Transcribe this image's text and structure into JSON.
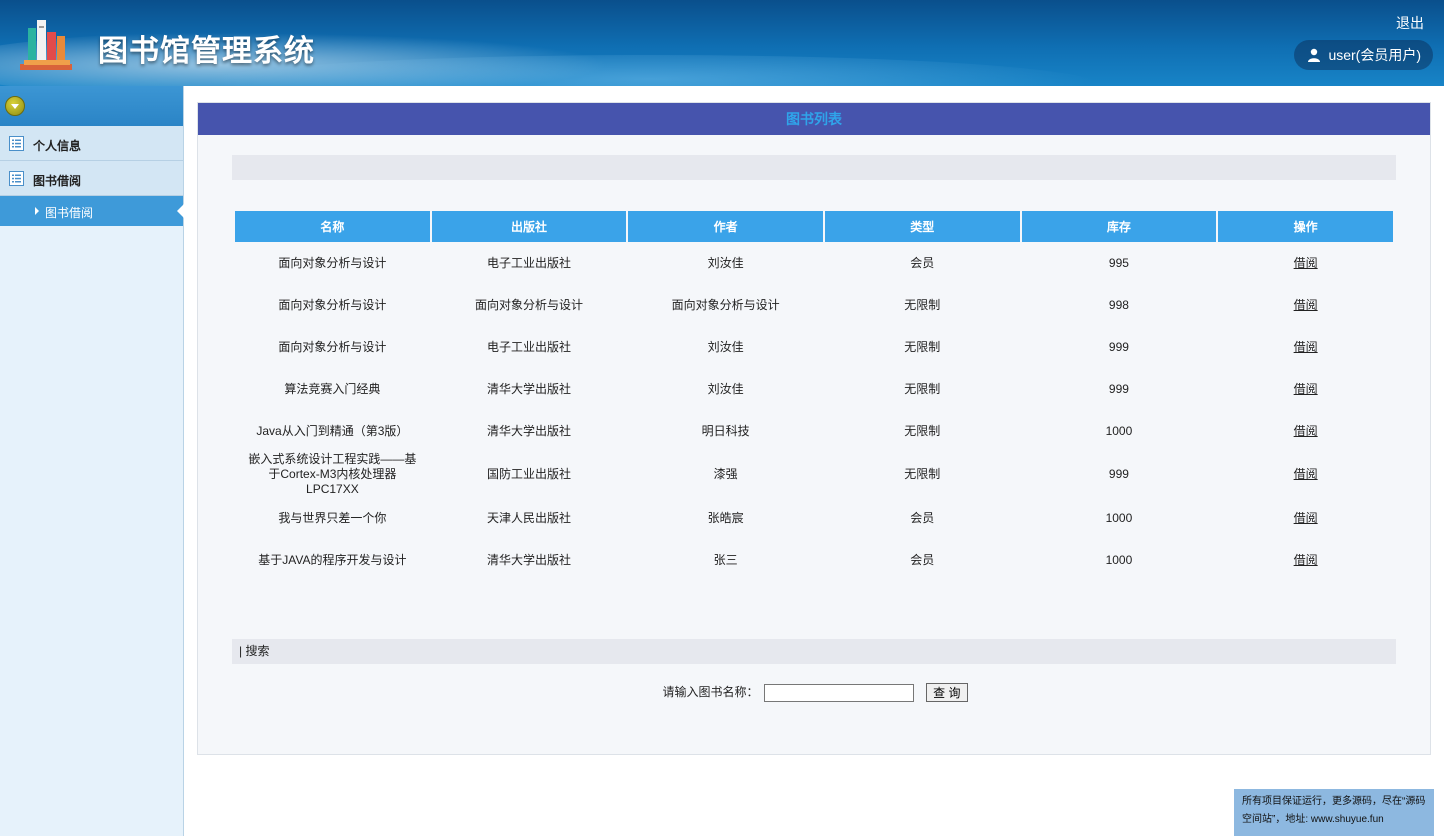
{
  "header": {
    "title": "图书馆管理系统",
    "logout": "退出",
    "user": "user(会员用户)"
  },
  "sidebar": {
    "groups": [
      {
        "label": "个人信息"
      },
      {
        "label": "图书借阅"
      }
    ],
    "sub_items": [
      {
        "label": "图书借阅"
      }
    ]
  },
  "main": {
    "panel_title": "图书列表",
    "table": {
      "columns": [
        "名称",
        "出版社",
        "作者",
        "类型",
        "库存",
        "操作"
      ],
      "rows": [
        [
          "面向对象分析与设计",
          "电子工业出版社",
          "刘汝佳",
          "会员",
          "995",
          "借阅"
        ],
        [
          "面向对象分析与设计",
          "面向对象分析与设计",
          "面向对象分析与设计",
          "无限制",
          "998",
          "借阅"
        ],
        [
          "面向对象分析与设计",
          "电子工业出版社",
          "刘汝佳",
          "无限制",
          "999",
          "借阅"
        ],
        [
          "算法竞赛入门经典",
          "清华大学出版社",
          "刘汝佳",
          "无限制",
          "999",
          "借阅"
        ],
        [
          "Java从入门到精通（第3版）",
          "清华大学出版社",
          "明日科技",
          "无限制",
          "1000",
          "借阅"
        ],
        [
          "嵌入式系统设计工程实践——基于Cortex-M3内核处理器LPC17XX",
          "国防工业出版社",
          "漆强",
          "无限制",
          "999",
          "借阅"
        ],
        [
          "我与世界只差一个你",
          "天津人民出版社",
          "张皓宸",
          "会员",
          "1000",
          "借阅"
        ],
        [
          "基于JAVA的程序开发与设计",
          "清华大学出版社",
          "张三",
          "会员",
          "1000",
          "借阅"
        ]
      ]
    },
    "search": {
      "section_label": "| 搜索",
      "field_label": "请输入图书名称：",
      "value": "",
      "button": "查 询"
    }
  },
  "footer": {
    "line1": "所有项目保证运行，更多源码，尽在“源码",
    "line2": "空间站”，地址: www.shuyue.fun"
  }
}
